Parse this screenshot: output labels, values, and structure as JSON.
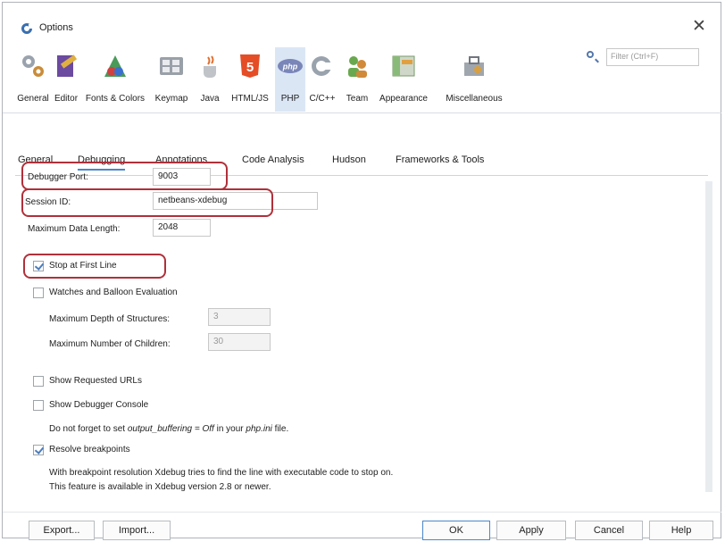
{
  "window": {
    "title": "Options",
    "close_glyph": "✕"
  },
  "filter": {
    "placeholder": "Filter (Ctrl+F)"
  },
  "categories": [
    {
      "label": "General",
      "icon": "general-gears-icon"
    },
    {
      "label": "Editor",
      "icon": "editor-pen-icon"
    },
    {
      "label": "Fonts & Colors",
      "icon": "fonts-colors-palette-icon"
    },
    {
      "label": "Keymap",
      "icon": "keymap-keyboard-icon"
    },
    {
      "label": "Java",
      "icon": "java-cup-icon"
    },
    {
      "label": "HTML/JS",
      "icon": "html5-shield-icon"
    },
    {
      "label": "PHP",
      "icon": "php-logo-icon",
      "selected": true
    },
    {
      "label": "C/C++",
      "icon": "cpp-logo-icon"
    },
    {
      "label": "Team",
      "icon": "team-people-icon"
    },
    {
      "label": "Appearance",
      "icon": "appearance-window-icon"
    },
    {
      "label": "Miscellaneous",
      "icon": "miscellaneous-toolbox-icon"
    }
  ],
  "tabs": [
    {
      "label": "General"
    },
    {
      "label": "Debugging",
      "active": true
    },
    {
      "label": "Annotations"
    },
    {
      "label": "Code Analysis"
    },
    {
      "label": "Hudson"
    },
    {
      "label": "Frameworks & Tools"
    }
  ],
  "debugging": {
    "debugger_port": {
      "label": "Debugger Port:",
      "value": "9003"
    },
    "session_id": {
      "label": "Session ID:",
      "value": "netbeans-xdebug"
    },
    "max_data_length": {
      "label": "Maximum Data Length:",
      "value": "2048"
    },
    "stop_first_line": {
      "label": "Stop at First Line",
      "checked": true
    },
    "watches_balloon": {
      "label": "Watches and Balloon Evaluation",
      "checked": false
    },
    "max_depth": {
      "label": "Maximum Depth of Structures:",
      "value": "3"
    },
    "max_children": {
      "label": "Maximum Number of Children:",
      "value": "30"
    },
    "show_urls": {
      "label": "Show Requested URLs",
      "checked": false
    },
    "show_console": {
      "label": "Show Debugger Console",
      "checked": false
    },
    "output_note": {
      "prefix": "Do not forget to set ",
      "setting": "output_buffering = Off",
      "middle": " in your ",
      "file": "php.ini",
      "suffix": " file."
    },
    "resolve_breakpoints": {
      "label": "Resolve breakpoints",
      "checked": true
    },
    "resolve_note_line1": "With breakpoint resolution Xdebug tries to find the line with executable code to stop on.",
    "resolve_note_line2": "This feature is available in Xdebug version 2.8 or newer."
  },
  "buttons": {
    "export": "Export...",
    "import": "Import...",
    "ok": "OK",
    "apply": "Apply",
    "cancel": "Cancel",
    "help": "Help"
  },
  "colors": {
    "highlight": "#b0303a",
    "selected_tab": "#dbe6f5",
    "accent": "#4b86c8"
  }
}
